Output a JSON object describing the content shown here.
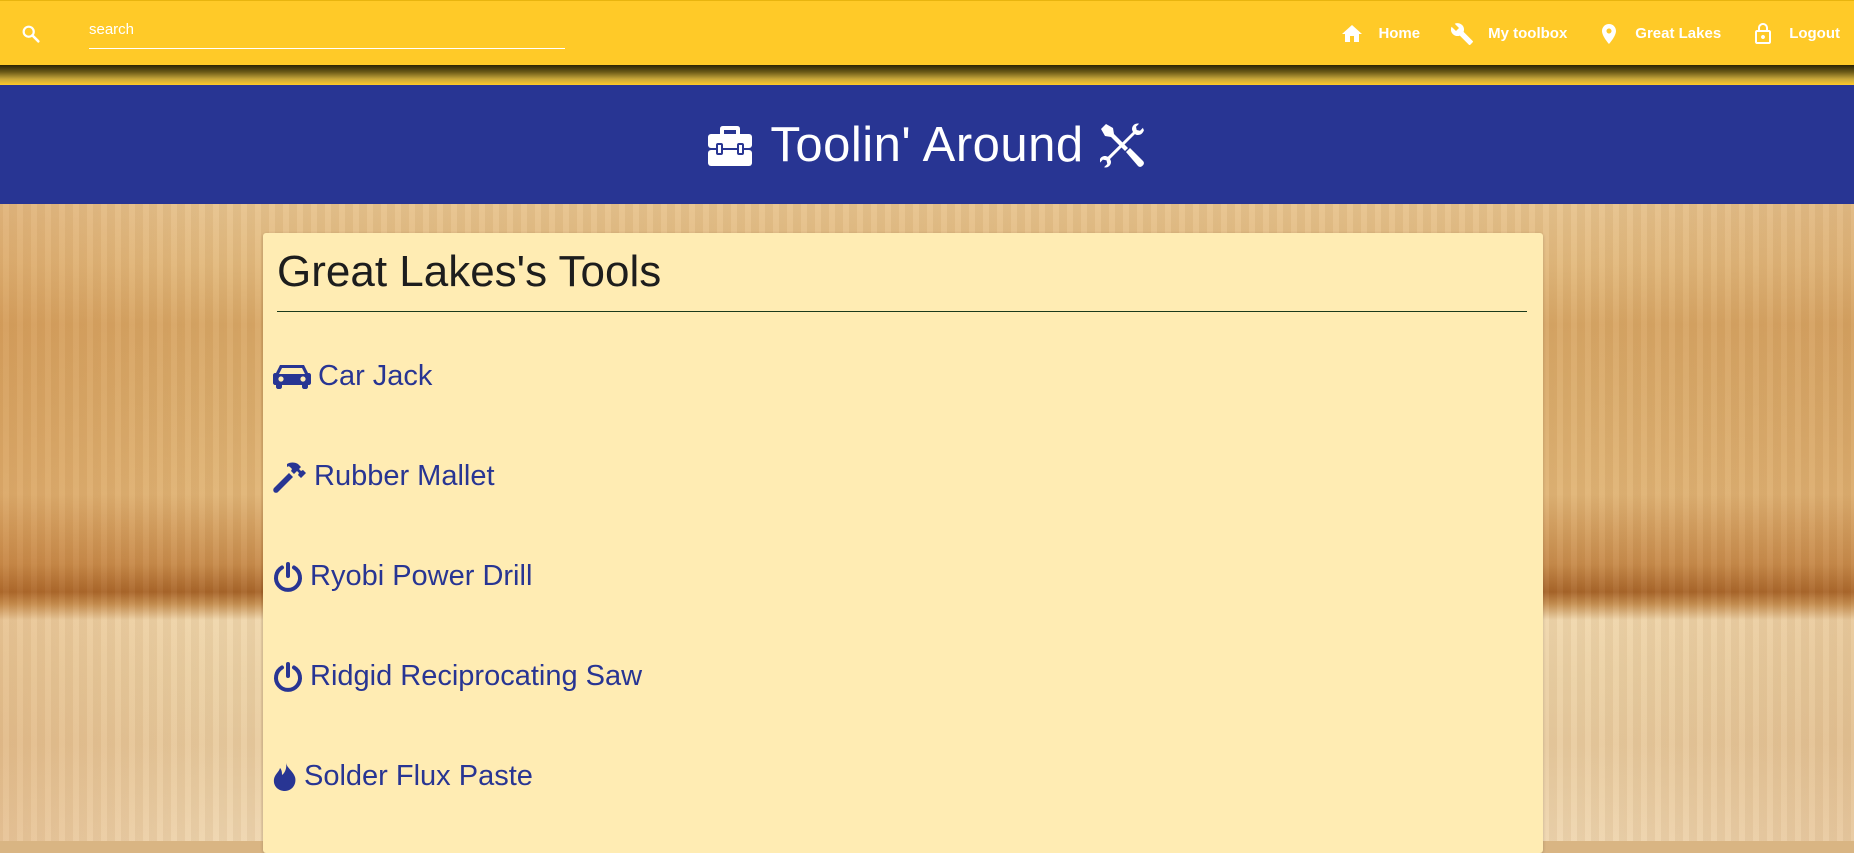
{
  "colors": {
    "topbar": "#ffca28",
    "banner": "#283593",
    "card": "#ffecb3",
    "link": "#283593"
  },
  "search": {
    "placeholder": "search",
    "value": "",
    "icon": "search-icon"
  },
  "nav": {
    "items": [
      {
        "label": "Home",
        "icon": "home-icon"
      },
      {
        "label": "My toolbox",
        "icon": "wrench-icon"
      },
      {
        "label": "Great Lakes",
        "icon": "location-pin-icon"
      },
      {
        "label": "Logout",
        "icon": "lock-icon"
      }
    ]
  },
  "banner": {
    "title": "Toolin' Around",
    "left_icon": "toolbox-icon",
    "right_icon": "tools-icon"
  },
  "page": {
    "title": "Great Lakes's Tools"
  },
  "tools": [
    {
      "label": "Car Jack",
      "icon": "car-icon"
    },
    {
      "label": "Rubber Mallet",
      "icon": "hammer-icon"
    },
    {
      "label": "Ryobi Power Drill",
      "icon": "power-icon"
    },
    {
      "label": "Ridgid Reciprocating Saw",
      "icon": "power-icon"
    },
    {
      "label": "Solder Flux Paste",
      "icon": "fire-icon"
    }
  ]
}
